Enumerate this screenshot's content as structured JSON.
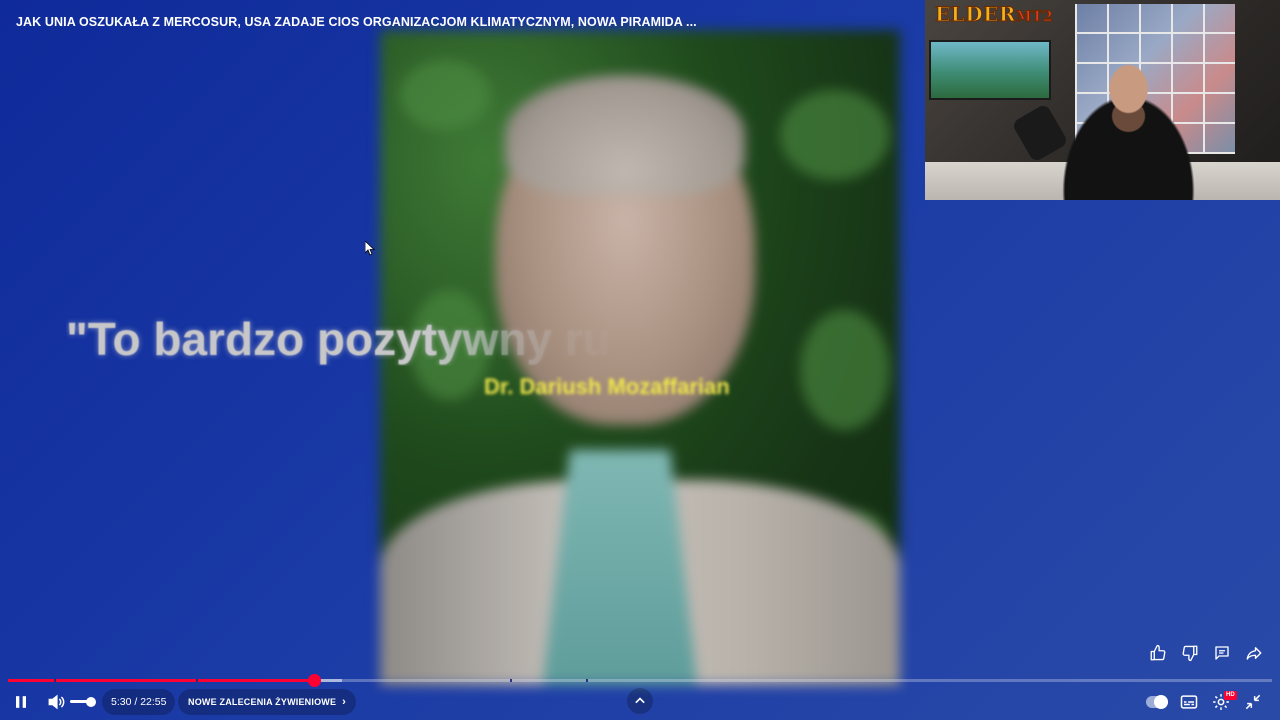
{
  "video": {
    "title": "JAK UNIA OSZUKAŁA Z MERCOSUR, USA ZADAJE CIOS ORGANIZACJOM KLIMATYCZNYM, NOWA PIRAMIDA ...",
    "quote_text": "\"To bardzo pozytywny ru",
    "caption_text": "Dr. Dariush Mozaffarian"
  },
  "stream_overlay": {
    "logo_text": "ELDER",
    "logo_suffix": "MT2"
  },
  "player": {
    "time_display": "5:30 / 22:55",
    "chapter_label": "NOWE ZALECENIA ŻYWIENIOWE",
    "played_fraction": 0.242,
    "buffered_fraction": 0.264,
    "chapter_gaps": [
      0.036,
      0.149,
      0.397,
      0.457
    ],
    "volume_fraction": 1.0,
    "hd_badge": "HD",
    "colors": {
      "accent": "#ff0033"
    }
  },
  "icons": {
    "like": "thumbs-up-icon",
    "dislike": "thumbs-down-icon",
    "comment": "comment-icon",
    "share": "share-icon",
    "pause": "pause-icon",
    "volume": "volume-icon",
    "chevron_up": "chevron-up-icon",
    "autoplay": "autoplay-toggle-icon",
    "subtitles": "subtitles-icon",
    "settings": "gear-icon",
    "exit_fullscreen": "exit-fullscreen-icon"
  }
}
